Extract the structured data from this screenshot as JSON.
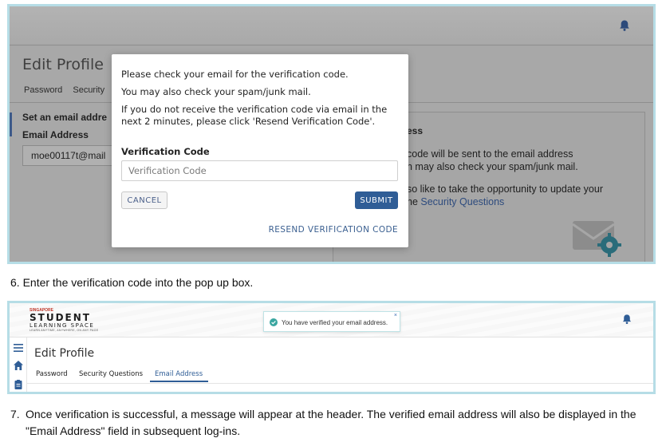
{
  "screen1": {
    "page_title": "Edit Profile",
    "tabs": [
      "Password",
      "Security"
    ],
    "set_email_label": "Set an email addre",
    "email_address_label": "Email Address",
    "email_value": "moe00117t@mail",
    "card_title": "ess",
    "card_text_1": "code will be sent to the email address",
    "card_text_2": "n may also check your spam/junk mail.",
    "card_text_3": "so like to take the opportunity to update your",
    "card_text_4_prefix": "he ",
    "card_link": "Security Questions",
    "modal": {
      "line1": "Please check your email for the verification code.",
      "line2": "You may also check your spam/junk mail.",
      "line3": "If you do not receive the verification code via email in the next 2 minutes, please click 'Resend Verification Code'.",
      "code_label": "Verification Code",
      "code_placeholder": "Verification Code",
      "cancel_label": "CANCEL",
      "submit_label": "SUBMIT",
      "resend_label": "RESEND VERIFICATION CODE"
    }
  },
  "captions": {
    "step6": "6. Enter the verification code into the pop up box.",
    "step7_num": "7.",
    "step7_text": "Once verification is successful, a message will appear at the header. The verified email address will also be displayed in the \"Email Address\" field in subsequent log-ins."
  },
  "screen2": {
    "logo_top": "SINGAPORE",
    "logo_main": "STUDENT",
    "logo_sub": "LEARNING SPACE",
    "logo_tag": "LEARN ANYTIME, ANYWHERE, ON ANY PAGE",
    "toast_text": "You have verified your email address.",
    "toast_close": "×",
    "page_title": "Edit Profile",
    "tabs": [
      "Password",
      "Security Questions",
      "Email Address"
    ]
  },
  "colors": {
    "accent": "#2f5d96",
    "frame_border": "#b6dde6",
    "overlay_grey": "#a8a8a8"
  },
  "icons": [
    "bell-icon",
    "envelope-gear-icon",
    "check-circle-icon",
    "close-icon",
    "menu-icon",
    "home-icon",
    "clipboard-icon"
  ]
}
